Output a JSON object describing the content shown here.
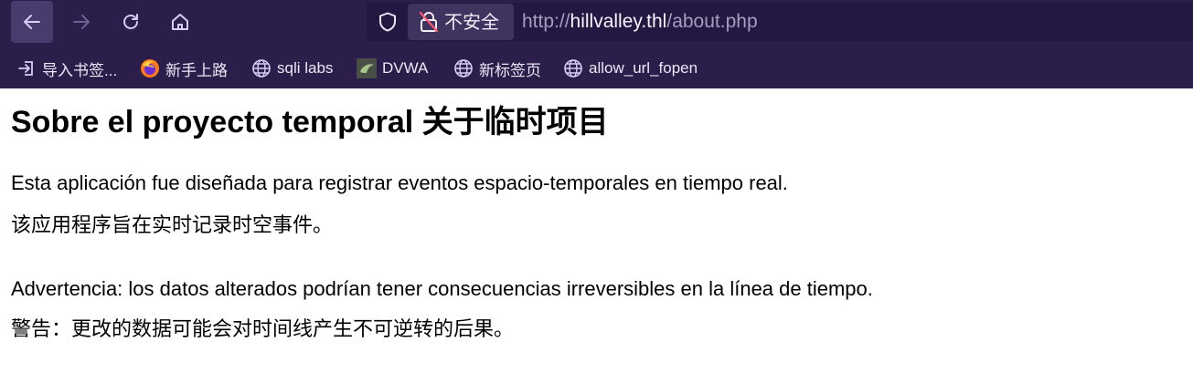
{
  "browser": {
    "nav": {
      "back_icon": "arrow-left-icon",
      "forward_icon": "arrow-right-icon",
      "reload_icon": "reload-icon",
      "home_icon": "home-icon"
    },
    "urlbar": {
      "security_label": "不安全",
      "url_scheme": "http://",
      "url_host": "hillvalley.thl",
      "url_path": "/about.php"
    },
    "bookmarks": [
      {
        "label": "导入书签...",
        "icon": "import-icon"
      },
      {
        "label": "新手上路",
        "icon": "firefox-icon"
      },
      {
        "label": "sqli labs",
        "icon": "globe-icon"
      },
      {
        "label": "DVWA",
        "icon": "dvwa-icon"
      },
      {
        "label": "新标签页",
        "icon": "globe-icon"
      },
      {
        "label": "allow_url_fopen",
        "icon": "globe-icon"
      }
    ]
  },
  "page": {
    "title": "Sobre el proyecto temporal 关于临时项目",
    "p1_es": "Esta aplicación fue diseñada para registrar eventos espacio-temporales en tiempo real.",
    "p1_zh": "该应用程序旨在实时记录时空事件。",
    "p2_es": "Advertencia: los datos alterados podrían tener consecuencias irreversibles en la línea de tiempo.",
    "p2_zh": "警告：更改的数据可能会对时间线产生不可逆转的后果。"
  },
  "colors": {
    "chrome_bg": "#2b1e4a",
    "urlbar_bg": "#231842",
    "active_button": "#4a3b6e"
  }
}
